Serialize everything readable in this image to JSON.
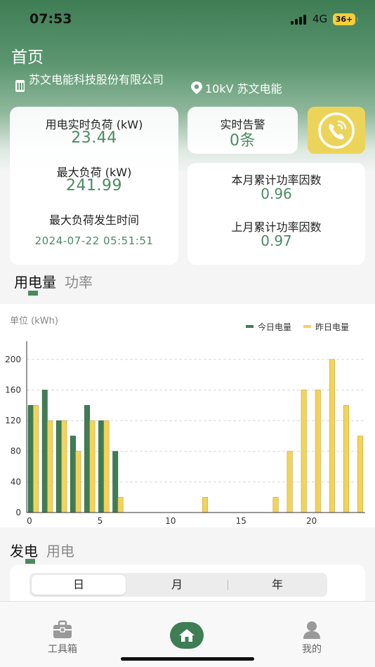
{
  "status": {
    "time": "07:53",
    "network": "4G",
    "battery": "36+"
  },
  "header": {
    "title": "首页",
    "company": "苏文电能科技股份有限公司",
    "station": "10kV 苏文电能"
  },
  "load_card": {
    "realtime_label": "用电实时负荷 (kW)",
    "realtime_value": "23.44",
    "max_label": "最大负荷 (kW)",
    "max_value": "241.99",
    "max_time_label": "最大负荷发生时间",
    "max_time_value": "2024-07-22 05:51:51"
  },
  "alarm_card": {
    "label": "实时告警",
    "value": "0条"
  },
  "pf_card": {
    "this_month_label": "本月累计功率因数",
    "this_month_value": "0.96",
    "last_month_label": "上月累计功率因数",
    "last_month_value": "0.97"
  },
  "tabs_energy": {
    "tab1": "用电量",
    "tab2": "功率"
  },
  "chart_data": {
    "type": "bar",
    "unit_label": "单位 (kWh)",
    "x": [
      0,
      1,
      2,
      3,
      4,
      5,
      6,
      7,
      8,
      9,
      10,
      11,
      12,
      13,
      14,
      15,
      16,
      17,
      18,
      19,
      20,
      21,
      22,
      23
    ],
    "x_tick_labels": [
      "0",
      "5",
      "10",
      "15",
      "20"
    ],
    "y_ticks": [
      0,
      40,
      80,
      120,
      160,
      200
    ],
    "ylim": [
      0,
      220
    ],
    "grid": true,
    "legend_position": "top-right",
    "series": [
      {
        "name": "今日电量",
        "color": "#3f7d55",
        "values": [
          140,
          160,
          120,
          100,
          140,
          120,
          80,
          null,
          null,
          null,
          null,
          null,
          null,
          null,
          null,
          null,
          null,
          null,
          null,
          null,
          null,
          null,
          null,
          null
        ]
      },
      {
        "name": "昨日电量",
        "color": "#f3d35a",
        "values": [
          140,
          120,
          120,
          80,
          120,
          120,
          20,
          0,
          0,
          0,
          0,
          0,
          20,
          0,
          0,
          0,
          0,
          20,
          80,
          160,
          160,
          200,
          140,
          100
        ]
      }
    ]
  },
  "tabs_gen": {
    "tab1": "发电",
    "tab2": "用电"
  },
  "segment": {
    "day": "日",
    "month": "月",
    "year": "年"
  },
  "tabbar": {
    "toolbox": "工具箱",
    "mine": "我的"
  }
}
